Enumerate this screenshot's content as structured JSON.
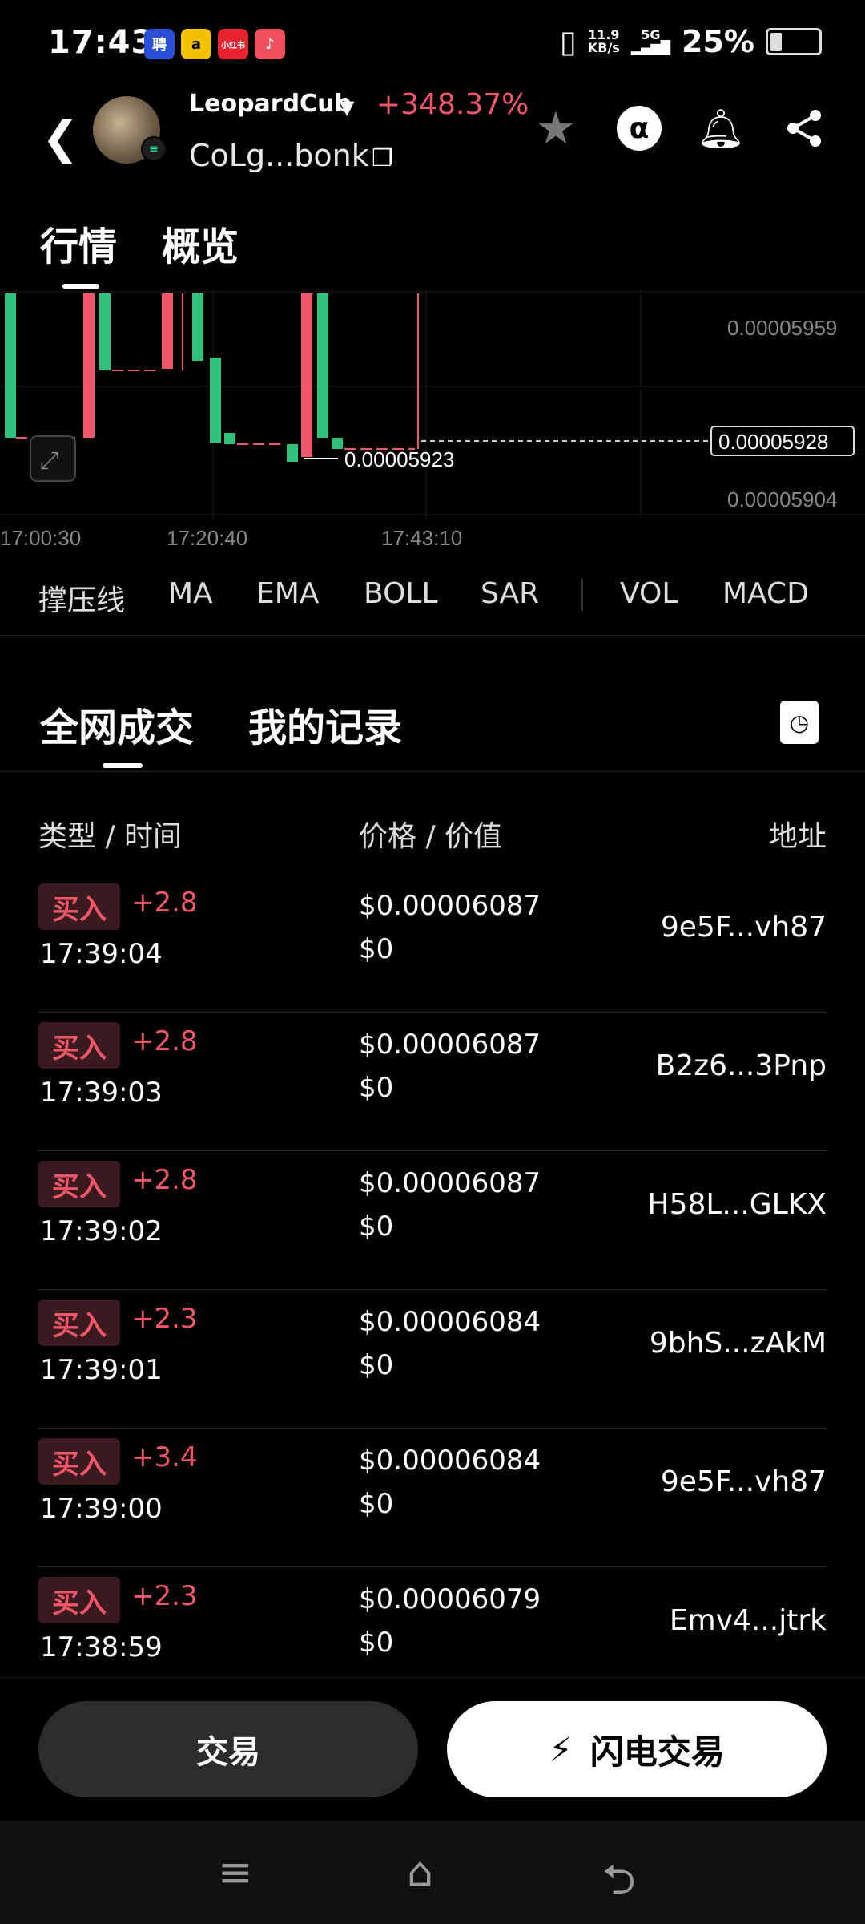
{
  "status_bar": {
    "time": "17:43",
    "net_speed_value": "11.9",
    "net_speed_unit": "KB/s",
    "network": "5G",
    "battery": "25%",
    "battery_level": 0.25,
    "app_icons": [
      "聘",
      "a",
      "小红书",
      "♪"
    ]
  },
  "header": {
    "token_name": "LeopardCub",
    "change_pct": "+348.37%",
    "address_short": "CoLg...bonk",
    "alpha_label": "α"
  },
  "tabs_top": [
    "行情",
    "概览"
  ],
  "chart": {
    "price_labels": [
      "0.00005959",
      "0.00005928",
      "0.00005904"
    ],
    "low_label": "0.00005923",
    "time_labels": [
      "17:00:30",
      "17:20:40",
      "17:43:10"
    ]
  },
  "indicators": [
    "撑压线",
    "MA",
    "EMA",
    "BOLL",
    "SAR",
    "VOL",
    "MACD"
  ],
  "tabs_trades": [
    "全网成交",
    "我的记录"
  ],
  "columns": {
    "type_time": "类型 / 时间",
    "price_value": "价格 / 价值",
    "address": "地址"
  },
  "trades": [
    {
      "type": "买入",
      "amount": "+2.8",
      "time": "17:39:04",
      "price": "$0.00006087",
      "value": "$0",
      "address": "9e5F...vh87"
    },
    {
      "type": "买入",
      "amount": "+2.8",
      "time": "17:39:03",
      "price": "$0.00006087",
      "value": "$0",
      "address": "B2z6...3Pnp"
    },
    {
      "type": "买入",
      "amount": "+2.8",
      "time": "17:39:02",
      "price": "$0.00006087",
      "value": "$0",
      "address": "H58L...GLKX"
    },
    {
      "type": "买入",
      "amount": "+2.3",
      "time": "17:39:01",
      "price": "$0.00006084",
      "value": "$0",
      "address": "9bhS...zAkM"
    },
    {
      "type": "买入",
      "amount": "+3.4",
      "time": "17:39:00",
      "price": "$0.00006084",
      "value": "$0",
      "address": "9e5F...vh87"
    },
    {
      "type": "买入",
      "amount": "+2.3",
      "time": "17:38:59",
      "price": "$0.00006079",
      "value": "$0",
      "address": "Emv4...jtrk"
    }
  ],
  "buttons": {
    "trade": "交易",
    "flash_trade": "闪电交易"
  },
  "colors": {
    "up": "#f0566a",
    "down_green": "#2ec27e",
    "background": "#000000"
  }
}
